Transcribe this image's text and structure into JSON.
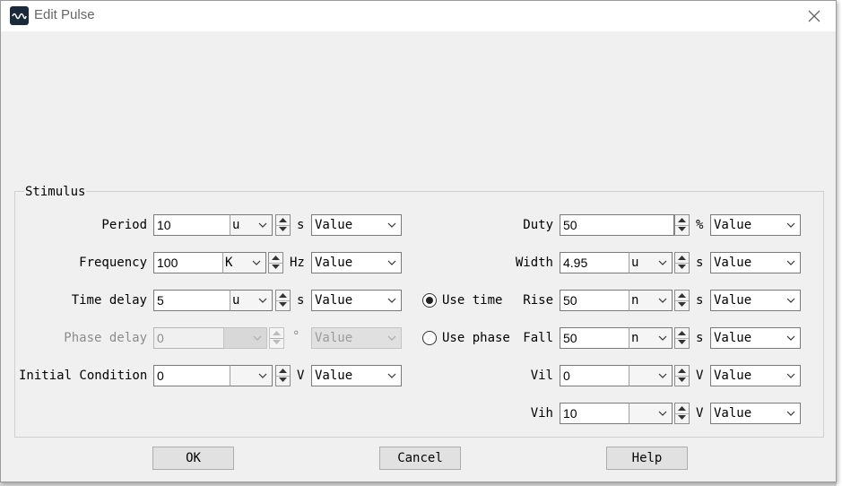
{
  "window": {
    "title": "Edit Pulse"
  },
  "group": {
    "label": "Stimulus"
  },
  "left": {
    "period": {
      "label": "Period",
      "value": "10",
      "unit_prefix": "u",
      "unit": "s",
      "mode": "Value"
    },
    "frequency": {
      "label": "Frequency",
      "value": "100",
      "unit_prefix": "K",
      "unit": "Hz",
      "mode": "Value"
    },
    "time_delay": {
      "label": "Time delay",
      "value": "5",
      "unit_prefix": "u",
      "unit": "s",
      "mode": "Value"
    },
    "phase_delay": {
      "label": "Phase delay",
      "value": "0",
      "unit_prefix": "",
      "unit": "°",
      "mode": "Value"
    },
    "initial_condition": {
      "label": "Initial Condition",
      "value": "0",
      "unit_prefix": "",
      "unit": "V",
      "mode": "Value"
    }
  },
  "radios": {
    "use_time": {
      "label": "Use time",
      "selected": true
    },
    "use_phase": {
      "label": "Use phase",
      "selected": false
    }
  },
  "right": {
    "duty": {
      "label": "Duty",
      "value": "50",
      "unit": "%",
      "mode": "Value"
    },
    "width": {
      "label": "Width",
      "value": "4.95",
      "unit_prefix": "u",
      "unit": "s",
      "mode": "Value"
    },
    "rise": {
      "label": "Rise",
      "value": "50",
      "unit_prefix": "n",
      "unit": "s",
      "mode": "Value"
    },
    "fall": {
      "label": "Fall",
      "value": "50",
      "unit_prefix": "n",
      "unit": "s",
      "mode": "Value"
    },
    "vil": {
      "label": "Vil",
      "value": "0",
      "unit_prefix": "",
      "unit": "V",
      "mode": "Value"
    },
    "vih": {
      "label": "Vih",
      "value": "10",
      "unit_prefix": "",
      "unit": "V",
      "mode": "Value"
    }
  },
  "buttons": {
    "ok": "OK",
    "cancel": "Cancel",
    "help": "Help"
  },
  "icons": {
    "app": "waveform-icon",
    "close": "close-icon"
  },
  "colors": {
    "dialog_bg": "#f0f0f0",
    "titlebar_bg": "#ffffff",
    "app_icon_bg": "#1b2a3a"
  }
}
